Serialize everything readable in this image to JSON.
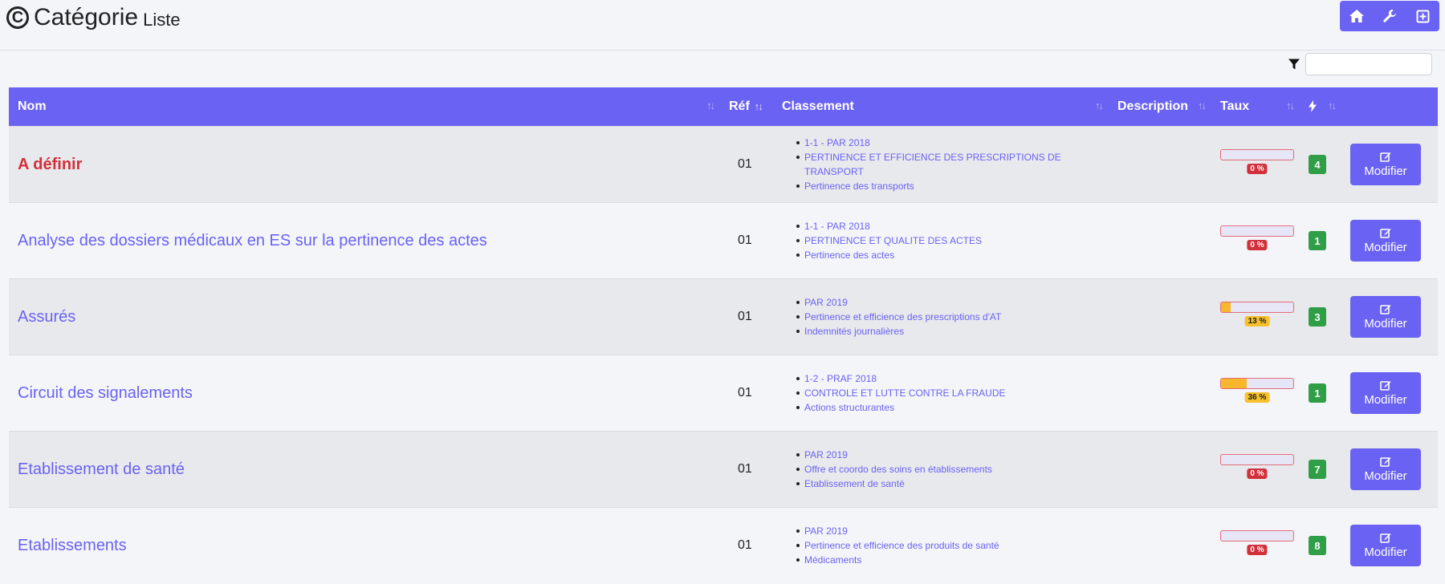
{
  "header": {
    "title": "Catégorie",
    "subtitle": "Liste",
    "title_icon": "copyright-icon"
  },
  "toolbar": {
    "buttons": [
      {
        "icon": "home-icon"
      },
      {
        "icon": "wrench-icon"
      },
      {
        "icon": "plus-square-icon"
      }
    ]
  },
  "filter": {
    "icon": "filter-icon",
    "value": "",
    "placeholder": ""
  },
  "table": {
    "columns": {
      "name": "Nom",
      "ref": "Réf",
      "classement": "Classement",
      "description": "Description",
      "taux": "Taux",
      "count_icon": "lightning-icon"
    },
    "action_label": "Modifier",
    "rows": [
      {
        "name": "A définir",
        "undefined": true,
        "ref": "01",
        "classement": [
          "1-1 - PAR 2018",
          "PERTINENCE ET EFFICIENCE DES PRESCRIPTIONS DE TRANSPORT",
          "Pertinence des transports"
        ],
        "description": "",
        "taux_value": 0,
        "taux_label": "0 %",
        "count": "4"
      },
      {
        "name": "Analyse des dossiers médicaux en ES sur la pertinence des actes",
        "undefined": false,
        "ref": "01",
        "classement": [
          "1-1 - PAR 2018",
          "PERTINENCE ET QUALITE DES ACTES",
          "Pertinence des actes"
        ],
        "description": "",
        "taux_value": 0,
        "taux_label": "0 %",
        "count": "1"
      },
      {
        "name": "Assurés",
        "undefined": false,
        "ref": "01",
        "classement": [
          "PAR 2019",
          "Pertinence et efficience des prescriptions d'AT",
          "Indemnités journalières"
        ],
        "description": "",
        "taux_value": 13,
        "taux_label": "13 %",
        "count": "3"
      },
      {
        "name": "Circuit des signalements",
        "undefined": false,
        "ref": "01",
        "classement": [
          "1-2 - PRAF 2018",
          "CONTROLE ET LUTTE CONTRE LA FRAUDE",
          "Actions structurantes"
        ],
        "description": "",
        "taux_value": 36,
        "taux_label": "36 %",
        "count": "1"
      },
      {
        "name": "Etablissement de santé",
        "undefined": false,
        "ref": "01",
        "classement": [
          "PAR 2019",
          "Offre et coordo des soins en établissements",
          "Etablissement de santé"
        ],
        "description": "",
        "taux_value": 0,
        "taux_label": "0 %",
        "count": "7"
      },
      {
        "name": "Etablissements",
        "undefined": false,
        "ref": "01",
        "classement": [
          "PAR 2019",
          "Pertinence et efficience des produits de santé",
          "Médicaments"
        ],
        "description": "",
        "taux_value": 0,
        "taux_label": "0 %",
        "count": "8"
      }
    ]
  }
}
